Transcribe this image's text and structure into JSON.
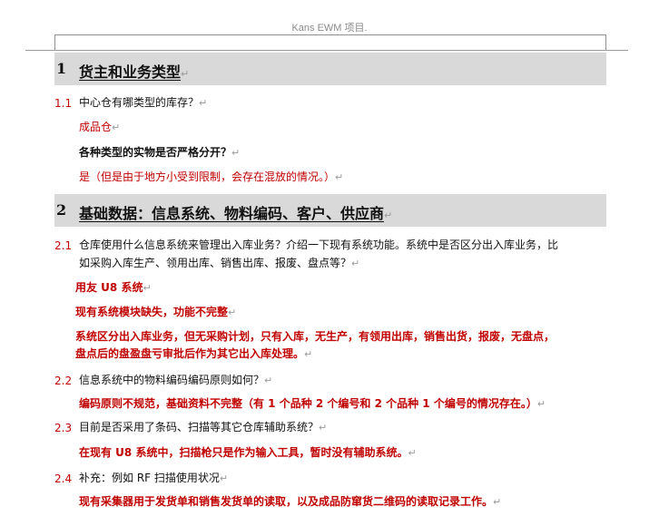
{
  "header": {
    "text": "Kans EWM 项目."
  },
  "para_mark": "↵",
  "sections": [
    {
      "num": "1",
      "title": "货主和业务类型",
      "items": [
        {
          "num": "1.1",
          "question": "中心仓有哪类型的库存？",
          "lines": [
            "成品仓",
            "各种类型的实物是否严格分开？",
            "是（但是由于地方小受到限制，会存在混放的情况。）"
          ]
        }
      ]
    },
    {
      "num": "2",
      "title": "基础数据：信息系统、物料编码、客户、供应商",
      "items": [
        {
          "num": "2.1",
          "question_lines": [
            "仓库使用什么信息系统来管理出入库业务？介绍一下现有系统功能。系统中是否区分出入库业务，比",
            "如采购入库生产、领用出库、销售出库、报废、盘点等？"
          ],
          "lines": [
            "用友 U8 系统",
            "现有系统模块缺失，功能不完整",
            "系统区分出入库业务，但无采购计划，只有入库，无生产，有领用出库，销售出货，报废，无盘点，",
            "盘点后的盘盈盘亏审批后作为其它出入库处理。"
          ]
        },
        {
          "num": "2.2",
          "question": "信息系统中的物料编码编码原则如何？",
          "lines": [
            "编码原则不规范，基础资料不完整（有 1 个品种 2 个编号和 2 个品种 1 个编号的情况存在。）"
          ]
        },
        {
          "num": "2.3",
          "question": "目前是否采用了条码、扫描等其它仓库辅助系统？",
          "lines": [
            "在现有 U8 系统中，扫描枪只是作为输入工具，暂时没有辅助系统。"
          ]
        },
        {
          "num": "2.4",
          "question": "补充：例如 RF 扫描使用状况",
          "lines": [
            "现有采集器用于发货单和销售发货单的读取，以及成品防窜货二维码的读取记录工作。"
          ]
        }
      ]
    }
  ]
}
